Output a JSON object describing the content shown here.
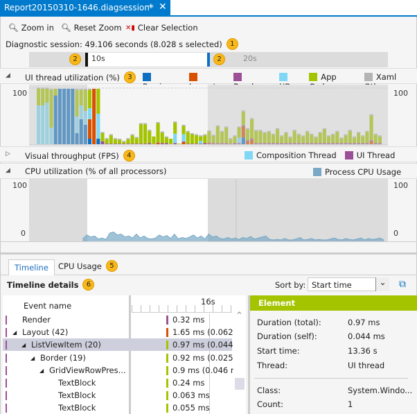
{
  "document_tab": {
    "title": "Report20150310-1646.diagsession*",
    "pin_icon": "pin-icon",
    "close_icon": "close-icon"
  },
  "toolbar": {
    "zoom_in": "Zoom in",
    "reset_zoom": "Reset Zoom",
    "clear_selection": "Clear Selection"
  },
  "session": {
    "summary": "Diagnostic session: 49.106 seconds (8.028 s selected)"
  },
  "badges": [
    "1",
    "2",
    "2",
    "3",
    "4",
    "5",
    "6"
  ],
  "ruler": {
    "labels": [
      "10s",
      "20s"
    ]
  },
  "ui_thread": {
    "title": "UI thread utilization (%)",
    "y_max_label": "100",
    "legend": [
      {
        "name": "Parsing",
        "color": "#0e70c0"
      },
      {
        "name": "Layout",
        "color": "#d85000"
      },
      {
        "name": "Render",
        "color": "#9b4f96"
      },
      {
        "name": "I/O",
        "color": "#7fd7f5"
      },
      {
        "name": "App Code",
        "color": "#a4c400"
      },
      {
        "name": "Xaml Oth...",
        "color": "#b4b4b4"
      }
    ],
    "bars": [
      [
        0,
        0,
        0,
        70,
        30,
        2
      ],
      [
        0,
        0,
        0,
        70,
        30,
        2
      ],
      [
        0,
        0,
        0,
        75,
        25,
        2
      ],
      [
        0,
        0,
        0,
        30,
        68,
        2
      ],
      [
        88,
        0,
        0,
        0,
        12,
        0
      ],
      [
        100,
        0,
        0,
        0,
        0,
        0
      ],
      [
        100,
        0,
        0,
        0,
        0,
        0
      ],
      [
        100,
        0,
        0,
        0,
        0,
        0
      ],
      [
        100,
        0,
        0,
        0,
        0,
        0
      ],
      [
        20,
        0,
        0,
        30,
        48,
        2
      ],
      [
        45,
        0,
        0,
        25,
        28,
        2
      ],
      [
        35,
        0,
        0,
        25,
        38,
        2
      ],
      [
        10,
        35,
        0,
        20,
        33,
        2
      ],
      [
        0,
        100,
        0,
        0,
        0,
        0
      ],
      [
        10,
        0,
        0,
        45,
        45,
        0
      ],
      [
        0,
        0,
        5,
        0,
        15,
        2
      ],
      [
        0,
        0,
        1,
        0,
        8,
        2
      ],
      [
        0,
        0,
        1,
        0,
        15,
        2
      ],
      [
        0,
        0,
        1,
        0,
        8,
        2
      ],
      [
        0,
        0,
        1,
        0,
        7,
        2
      ],
      [
        0,
        0,
        1,
        0,
        3,
        2
      ],
      [
        0,
        0,
        1,
        0,
        8,
        2
      ],
      [
        0,
        0,
        1,
        0,
        15,
        2
      ],
      [
        0,
        0,
        1,
        0,
        10,
        2
      ],
      [
        0,
        0,
        1,
        0,
        35,
        2
      ],
      [
        0,
        0,
        1,
        0,
        35,
        2
      ],
      [
        0,
        0,
        2,
        0,
        22,
        2
      ],
      [
        0,
        0,
        0,
        0,
        14,
        0
      ],
      [
        0,
        2,
        1,
        0,
        35,
        2
      ],
      [
        0,
        0,
        2,
        0,
        19,
        2
      ],
      [
        0,
        0,
        2,
        0,
        10,
        2
      ],
      [
        0,
        0,
        0,
        0,
        10,
        0
      ],
      [
        0,
        0,
        2,
        17,
        20,
        2
      ],
      [
        0,
        0,
        0,
        0,
        1,
        0
      ],
      [
        0,
        4,
        1,
        13,
        15,
        2
      ],
      [
        0,
        0,
        1,
        0,
        21,
        2
      ],
      [
        0,
        0,
        1,
        0,
        17,
        2
      ],
      [
        0,
        0,
        1,
        0,
        15,
        2
      ],
      [
        0,
        0,
        1,
        5,
        8,
        2
      ],
      [
        0,
        0,
        2,
        0,
        14,
        2
      ],
      [
        0,
        2,
        1,
        0,
        20,
        2
      ],
      [
        0,
        0,
        2,
        0,
        13,
        2
      ],
      [
        0,
        1,
        1,
        0,
        30,
        2
      ],
      [
        0,
        0,
        2,
        0,
        20,
        2
      ],
      [
        0,
        0,
        2,
        0,
        28,
        2
      ],
      [
        0,
        0,
        1,
        0,
        8,
        2
      ],
      [
        0,
        0,
        2,
        0,
        12,
        2
      ],
      [
        0,
        0,
        2,
        10,
        18,
        2
      ],
      [
        12,
        20,
        2,
        0,
        25,
        2
      ],
      [
        0,
        5,
        2,
        0,
        20,
        2
      ],
      [
        0,
        8,
        2,
        0,
        35,
        2
      ],
      [
        0,
        0,
        2,
        0,
        22,
        2
      ],
      [
        0,
        0,
        2,
        0,
        22,
        2
      ],
      [
        0,
        0,
        2,
        0,
        18,
        2
      ],
      [
        0,
        0,
        2,
        0,
        20,
        2
      ],
      [
        0,
        0,
        2,
        0,
        15,
        2
      ],
      [
        0,
        0,
        2,
        0,
        25,
        2
      ],
      [
        0,
        0,
        2,
        0,
        12,
        2
      ],
      [
        0,
        0,
        2,
        0,
        18,
        2
      ],
      [
        0,
        0,
        2,
        0,
        10,
        2
      ],
      [
        0,
        0,
        2,
        0,
        22,
        2
      ],
      [
        0,
        0,
        2,
        0,
        15,
        2
      ],
      [
        0,
        0,
        2,
        0,
        12,
        2
      ],
      [
        0,
        0,
        2,
        0,
        20,
        2
      ],
      [
        0,
        0,
        2,
        0,
        15,
        2
      ],
      [
        0,
        0,
        2,
        0,
        10,
        2
      ],
      [
        0,
        0,
        2,
        0,
        18,
        2
      ],
      [
        0,
        0,
        2,
        0,
        25,
        2
      ],
      [
        0,
        0,
        2,
        0,
        12,
        2
      ],
      [
        0,
        0,
        2,
        0,
        15,
        2
      ],
      [
        0,
        0,
        2,
        0,
        20,
        2
      ],
      [
        0,
        0,
        2,
        0,
        8,
        2
      ],
      [
        0,
        0,
        2,
        0,
        14,
        2
      ],
      [
        0,
        0,
        2,
        0,
        22,
        2
      ],
      [
        0,
        0,
        2,
        0,
        10,
        2
      ],
      [
        0,
        0,
        2,
        0,
        18,
        2
      ],
      [
        0,
        0,
        2,
        0,
        12,
        2
      ],
      [
        0,
        0,
        2,
        0,
        20,
        2
      ],
      [
        0,
        5,
        2,
        0,
        45,
        2
      ],
      [
        0,
        0,
        2,
        0,
        15,
        2
      ],
      [
        0,
        0,
        2,
        0,
        12,
        2
      ]
    ]
  },
  "visual_throughput": {
    "title": "Visual throughput (FPS)",
    "legend": [
      {
        "name": "Composition Thread",
        "color": "#7fd7f5"
      },
      {
        "name": "UI Thread",
        "color": "#9b4f96"
      }
    ]
  },
  "cpu": {
    "title": "CPU utilization (% of all processors)",
    "legend": [
      {
        "name": "Process CPU Usage",
        "color": "#79a9c6"
      }
    ],
    "y_max_label": "100",
    "y_min_label": "0",
    "values": [
      3,
      10,
      6,
      8,
      2,
      4,
      1,
      14,
      16,
      10,
      12,
      6,
      8,
      4,
      12,
      4,
      8,
      3,
      2,
      4,
      10,
      6,
      9,
      3,
      12,
      2,
      5,
      3,
      6,
      10,
      4,
      8,
      2,
      12,
      6,
      8,
      3,
      2,
      5,
      2,
      4,
      1,
      5,
      3,
      7,
      2,
      4,
      6,
      8,
      1,
      0,
      1,
      0,
      3,
      0,
      0,
      2,
      5,
      0,
      1,
      3,
      0,
      1,
      0,
      0,
      2,
      4,
      1,
      0,
      3,
      1,
      0,
      2,
      4,
      0,
      3,
      1,
      2,
      4,
      0
    ]
  },
  "bottom_tabs": [
    {
      "label": "Timeline"
    },
    {
      "label": "CPU Usage"
    }
  ],
  "details": {
    "title": "Timeline details",
    "sort_label": "Sort by:",
    "sort_value": "Start time",
    "column_event": "Event name",
    "ruler_label": "16s",
    "rows": [
      {
        "name": "Render",
        "indent": 0,
        "expander": "",
        "duration": "0.32 ms",
        "color": "#9b4f96"
      },
      {
        "name": "Layout (42)",
        "indent": 0,
        "expander": "◢",
        "duration": "1.65 ms (0.062",
        "color": "#d85000"
      },
      {
        "name": "ListViewItem (20)",
        "indent": 1,
        "expander": "◢",
        "duration": "0.97 ms (0.044",
        "color": "#a4c400",
        "selected": true
      },
      {
        "name": "Border (19)",
        "indent": 2,
        "expander": "◢",
        "duration": "0.92 ms (0.025",
        "color": "#a4c400"
      },
      {
        "name": "GridViewRowPres...",
        "indent": 3,
        "expander": "◢",
        "duration": "0.9 ms (0.046 m",
        "color": "#a4c400"
      },
      {
        "name": "TextBlock",
        "indent": 4,
        "expander": "",
        "duration": "0.24 ms",
        "color": "#a4c400"
      },
      {
        "name": "TextBlock",
        "indent": 4,
        "expander": "",
        "duration": "0.063 ms",
        "color": "#a4c400"
      },
      {
        "name": "TextBlock",
        "indent": 4,
        "expander": "",
        "duration": "0.055 ms",
        "color": "#a4c400"
      }
    ]
  },
  "element_panel": {
    "header": "Element",
    "header_color": "#a4c400",
    "props": [
      {
        "label": "Duration (total):",
        "value": "0.97 ms"
      },
      {
        "label": "Duration (self):",
        "value": "0.044 ms"
      },
      {
        "label": "Start time:",
        "value": "13.36 s"
      },
      {
        "label": "Thread:",
        "value": "UI thread"
      },
      {
        "label": "Class:",
        "value": "System.Windo..."
      },
      {
        "label": "Count:",
        "value": "1"
      }
    ]
  }
}
